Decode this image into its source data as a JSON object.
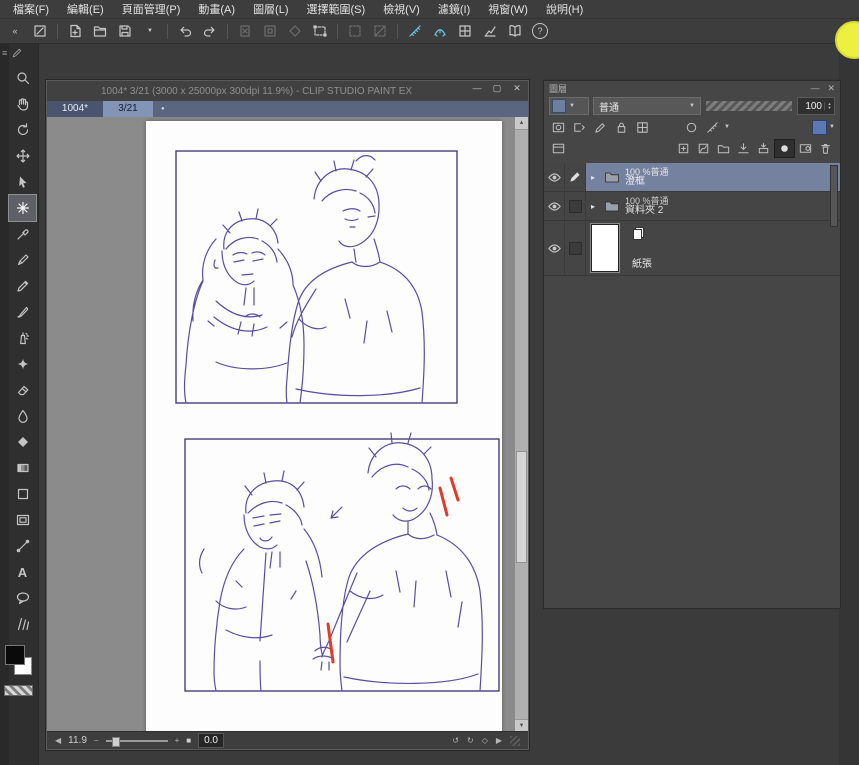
{
  "app": {
    "name": "CLIP STUDIO PAINT EX"
  },
  "menu_bar": {
    "items": [
      "檔案(F)",
      "編輯(E)",
      "頁面管理(P)",
      "動畫(A)",
      "圖層(L)",
      "選擇範圍(S)",
      "檢視(V)",
      "濾鏡(I)",
      "視窗(W)",
      "說明(H)"
    ]
  },
  "glyphs": {
    "collapse": "«",
    "panel_menu": "≡",
    "minimize": "—",
    "maximize": "▢",
    "close": "✕",
    "dot": "●",
    "expand": "▸",
    "dropdown": "▼",
    "spin_up": "▲",
    "spin_down": "▼",
    "scroll_up": "▲",
    "scroll_down": "▼",
    "nav_left": "◀",
    "nav_right": "▶",
    "zoom_out": "−",
    "zoom_in": "+",
    "zoom_reset": "■",
    "rotate_ccw": "↺",
    "rotate_cw": "↻",
    "rotate_reset": "◇",
    "help": "?",
    "text_tool": "A"
  },
  "canvas_window": {
    "title": "1004* 3/21 (3000 x 25000px 300dpi 11.9%)  - CLIP STUDIO PAINT EX",
    "tab_name": "1004*",
    "page_indicator": "3/21",
    "status": {
      "zoom": "11.9",
      "rotation": "0.0"
    }
  },
  "layer_panel": {
    "title": "圖層",
    "blend_mode": "普通",
    "opacity": "100",
    "layers": [
      {
        "info": "100 %普通",
        "name": "澄框"
      },
      {
        "info": "100 %普通",
        "name": "資料夾 2"
      },
      {
        "name": "紙張"
      }
    ]
  },
  "tools": {
    "selected": "selection",
    "names": [
      "zoom",
      "hand",
      "rotate-canvas",
      "move-layer",
      "object",
      "selection",
      "eyedropper",
      "pen",
      "pencil",
      "brush",
      "airbrush",
      "decoration",
      "eraser",
      "blend",
      "fill",
      "gradient",
      "figure",
      "frame-border",
      "correction",
      "text",
      "balloon",
      "flow-line"
    ]
  },
  "colors": {
    "accent_yellow": "#eef041",
    "selected_layer": "#74819f",
    "snap_active": "#6cc7e8",
    "sketch_line": "#5a4da0",
    "sketch_red": "#e03c28",
    "main_color": "#000000",
    "sub_color": "#ffffff"
  }
}
